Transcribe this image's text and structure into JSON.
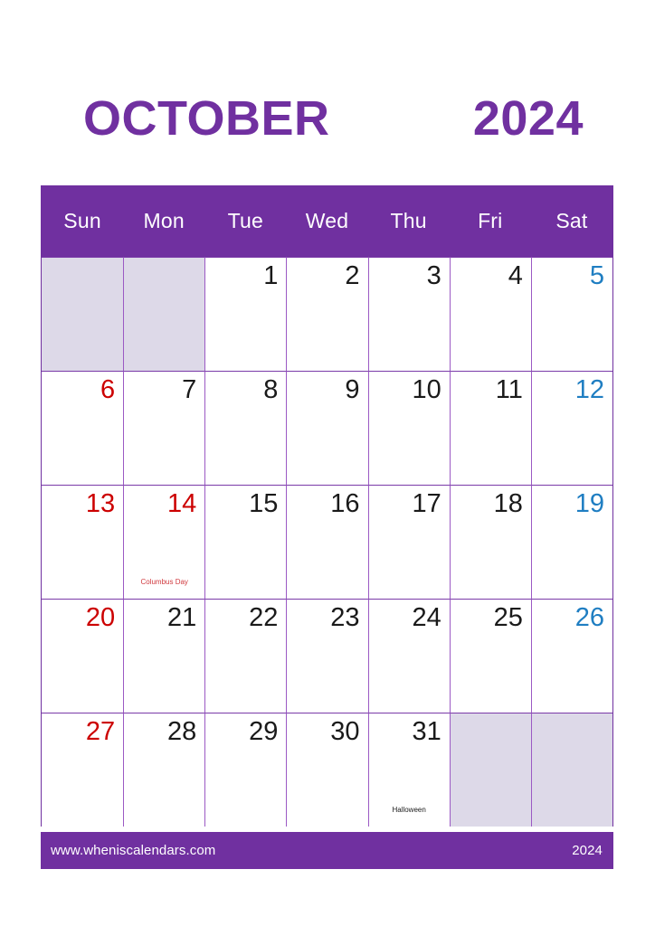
{
  "title": {
    "month": "OCTOBER",
    "year": "2024"
  },
  "colors": {
    "header_purple": "#7030a0",
    "grid_border": "#9b59c4",
    "blank_cell": "#ddd9e8",
    "sunday_red": "#cc0000",
    "saturday_blue": "#1f7ec2",
    "weekday_black": "#1a1a1a",
    "holiday_red": "#d0393e"
  },
  "weekdays": [
    {
      "label": "Sun"
    },
    {
      "label": "Mon"
    },
    {
      "label": "Tue"
    },
    {
      "label": "Wed"
    },
    {
      "label": "Thu"
    },
    {
      "label": "Fri"
    },
    {
      "label": "Sat"
    }
  ],
  "weeks": [
    [
      {
        "day": "",
        "kind": "blank",
        "event": ""
      },
      {
        "day": "",
        "kind": "blank",
        "event": ""
      },
      {
        "day": "1",
        "kind": "weekday",
        "event": ""
      },
      {
        "day": "2",
        "kind": "weekday",
        "event": ""
      },
      {
        "day": "3",
        "kind": "weekday",
        "event": ""
      },
      {
        "day": "4",
        "kind": "weekday",
        "event": ""
      },
      {
        "day": "5",
        "kind": "sat",
        "event": ""
      }
    ],
    [
      {
        "day": "6",
        "kind": "sun",
        "event": ""
      },
      {
        "day": "7",
        "kind": "weekday",
        "event": ""
      },
      {
        "day": "8",
        "kind": "weekday",
        "event": ""
      },
      {
        "day": "9",
        "kind": "weekday",
        "event": ""
      },
      {
        "day": "10",
        "kind": "weekday",
        "event": ""
      },
      {
        "day": "11",
        "kind": "weekday",
        "event": ""
      },
      {
        "day": "12",
        "kind": "sat",
        "event": ""
      }
    ],
    [
      {
        "day": "13",
        "kind": "sun",
        "event": ""
      },
      {
        "day": "14",
        "kind": "sun",
        "event": "Columbus Day",
        "event_style": "holiday"
      },
      {
        "day": "15",
        "kind": "weekday",
        "event": ""
      },
      {
        "day": "16",
        "kind": "weekday",
        "event": ""
      },
      {
        "day": "17",
        "kind": "weekday",
        "event": ""
      },
      {
        "day": "18",
        "kind": "weekday",
        "event": ""
      },
      {
        "day": "19",
        "kind": "sat",
        "event": ""
      }
    ],
    [
      {
        "day": "20",
        "kind": "sun",
        "event": ""
      },
      {
        "day": "21",
        "kind": "weekday",
        "event": ""
      },
      {
        "day": "22",
        "kind": "weekday",
        "event": ""
      },
      {
        "day": "23",
        "kind": "weekday",
        "event": ""
      },
      {
        "day": "24",
        "kind": "weekday",
        "event": ""
      },
      {
        "day": "25",
        "kind": "weekday",
        "event": ""
      },
      {
        "day": "26",
        "kind": "sat",
        "event": ""
      }
    ],
    [
      {
        "day": "27",
        "kind": "sun",
        "event": ""
      },
      {
        "day": "28",
        "kind": "weekday",
        "event": ""
      },
      {
        "day": "29",
        "kind": "weekday",
        "event": ""
      },
      {
        "day": "30",
        "kind": "weekday",
        "event": ""
      },
      {
        "day": "31",
        "kind": "weekday",
        "event": "Halloween",
        "event_style": "normal"
      },
      {
        "day": "",
        "kind": "blank",
        "event": ""
      },
      {
        "day": "",
        "kind": "blank",
        "event": ""
      }
    ]
  ],
  "footer": {
    "website": "www.wheniscalendars.com",
    "year": "2024"
  }
}
